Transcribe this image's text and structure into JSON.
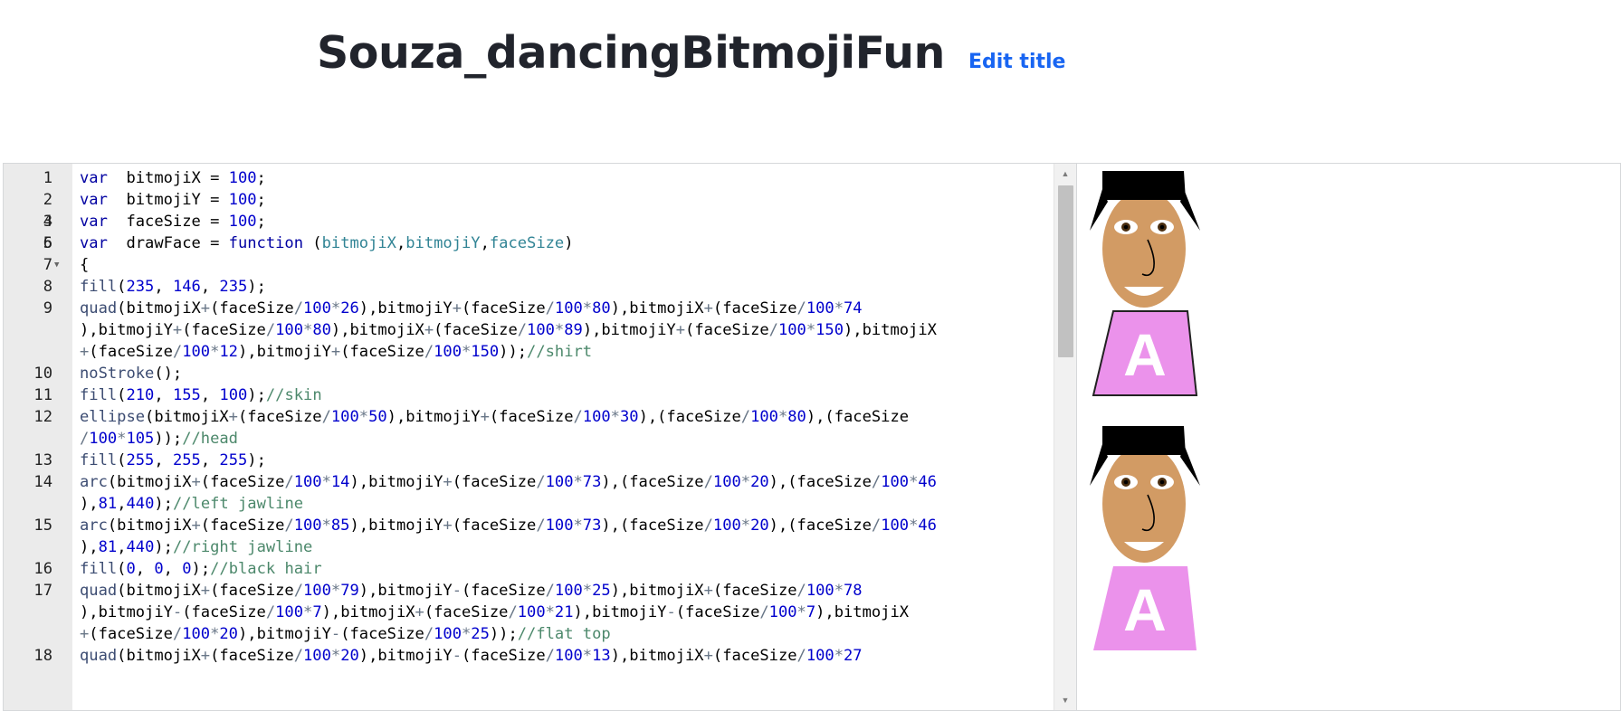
{
  "header": {
    "title": "Souza_dancingBitmojiFun",
    "edit_title_label": "Edit title"
  },
  "editor": {
    "lines": [
      {
        "num": "1",
        "tokens": [
          [
            "kw",
            "var"
          ],
          [
            "",
            "  bitmojiX = "
          ],
          [
            "num",
            "100"
          ],
          [
            "",
            ";"
          ]
        ]
      },
      {
        "num": "2",
        "tokens": [
          [
            "kw",
            "var"
          ],
          [
            "",
            "  bitmojiY = "
          ],
          [
            "num",
            "100"
          ],
          [
            "",
            ";"
          ]
        ]
      },
      {
        "num": "3",
        "tokens": [
          [
            "",
            ""
          ]
        ]
      },
      {
        "num": "4",
        "tokens": [
          [
            "kw",
            "var"
          ],
          [
            "",
            "  faceSize = "
          ],
          [
            "num",
            "100"
          ],
          [
            "",
            ";"
          ]
        ]
      },
      {
        "num": "5",
        "tokens": [
          [
            "",
            ""
          ]
        ]
      },
      {
        "num": "6",
        "tokens": [
          [
            "kw",
            "var"
          ],
          [
            "",
            "  drawFace = "
          ],
          [
            "kw",
            "function"
          ],
          [
            "",
            " ("
          ],
          [
            "param",
            "bitmojiX"
          ],
          [
            "",
            ","
          ],
          [
            "param",
            "bitmojiY"
          ],
          [
            "",
            ","
          ],
          [
            "param",
            "faceSize"
          ],
          [
            "",
            ")"
          ]
        ]
      },
      {
        "num": "7",
        "fold": true,
        "tokens": [
          [
            "",
            "{"
          ]
        ]
      },
      {
        "num": "8",
        "tokens": [
          [
            "fn",
            "fill"
          ],
          [
            "",
            "("
          ],
          [
            "num",
            "235"
          ],
          [
            "",
            ", "
          ],
          [
            "num",
            "146"
          ],
          [
            "",
            ", "
          ],
          [
            "num",
            "235"
          ],
          [
            "",
            ");"
          ]
        ]
      },
      {
        "num": "9",
        "tokens": [
          [
            "fn",
            "quad"
          ],
          [
            "",
            "(bitmojiX"
          ],
          [
            "op",
            "+"
          ],
          [
            "",
            "(faceSize"
          ],
          [
            "op",
            "/"
          ],
          [
            "num",
            "100"
          ],
          [
            "op",
            "*"
          ],
          [
            "num",
            "26"
          ],
          [
            "",
            "),bitmojiY"
          ],
          [
            "op",
            "+"
          ],
          [
            "",
            "(faceSize"
          ],
          [
            "op",
            "/"
          ],
          [
            "num",
            "100"
          ],
          [
            "op",
            "*"
          ],
          [
            "num",
            "80"
          ],
          [
            "",
            "),bitmojiX"
          ],
          [
            "op",
            "+"
          ],
          [
            "",
            "(faceSize"
          ],
          [
            "op",
            "/"
          ],
          [
            "num",
            "100"
          ],
          [
            "op",
            "*"
          ],
          [
            "num",
            "74"
          ]
        ]
      },
      {
        "num": "",
        "tokens": [
          [
            "",
            "),bitmojiY"
          ],
          [
            "op",
            "+"
          ],
          [
            "",
            "(faceSize"
          ],
          [
            "op",
            "/"
          ],
          [
            "num",
            "100"
          ],
          [
            "op",
            "*"
          ],
          [
            "num",
            "80"
          ],
          [
            "",
            "),bitmojiX"
          ],
          [
            "op",
            "+"
          ],
          [
            "",
            "(faceSize"
          ],
          [
            "op",
            "/"
          ],
          [
            "num",
            "100"
          ],
          [
            "op",
            "*"
          ],
          [
            "num",
            "89"
          ],
          [
            "",
            "),bitmojiY"
          ],
          [
            "op",
            "+"
          ],
          [
            "",
            "(faceSize"
          ],
          [
            "op",
            "/"
          ],
          [
            "num",
            "100"
          ],
          [
            "op",
            "*"
          ],
          [
            "num",
            "150"
          ],
          [
            "",
            "),bitmojiX"
          ]
        ]
      },
      {
        "num": "",
        "tokens": [
          [
            "op",
            "+"
          ],
          [
            "",
            "(faceSize"
          ],
          [
            "op",
            "/"
          ],
          [
            "num",
            "100"
          ],
          [
            "op",
            "*"
          ],
          [
            "num",
            "12"
          ],
          [
            "",
            "),bitmojiY"
          ],
          [
            "op",
            "+"
          ],
          [
            "",
            "(faceSize"
          ],
          [
            "op",
            "/"
          ],
          [
            "num",
            "100"
          ],
          [
            "op",
            "*"
          ],
          [
            "num",
            "150"
          ],
          [
            "",
            "));"
          ],
          [
            "cm",
            "//shirt"
          ]
        ]
      },
      {
        "num": "10",
        "tokens": [
          [
            "fn",
            "noStroke"
          ],
          [
            "",
            "();"
          ]
        ]
      },
      {
        "num": "11",
        "tokens": [
          [
            "fn",
            "fill"
          ],
          [
            "",
            "("
          ],
          [
            "num",
            "210"
          ],
          [
            "",
            ", "
          ],
          [
            "num",
            "155"
          ],
          [
            "",
            ", "
          ],
          [
            "num",
            "100"
          ],
          [
            "",
            ");"
          ],
          [
            "cm",
            "//skin"
          ]
        ]
      },
      {
        "num": "12",
        "tokens": [
          [
            "fn",
            "ellipse"
          ],
          [
            "",
            "(bitmojiX"
          ],
          [
            "op",
            "+"
          ],
          [
            "",
            "(faceSize"
          ],
          [
            "op",
            "/"
          ],
          [
            "num",
            "100"
          ],
          [
            "op",
            "*"
          ],
          [
            "num",
            "50"
          ],
          [
            "",
            "),bitmojiY"
          ],
          [
            "op",
            "+"
          ],
          [
            "",
            "(faceSize"
          ],
          [
            "op",
            "/"
          ],
          [
            "num",
            "100"
          ],
          [
            "op",
            "*"
          ],
          [
            "num",
            "30"
          ],
          [
            "",
            "),(faceSize"
          ],
          [
            "op",
            "/"
          ],
          [
            "num",
            "100"
          ],
          [
            "op",
            "*"
          ],
          [
            "num",
            "80"
          ],
          [
            "",
            "),(faceSize"
          ]
        ]
      },
      {
        "num": "",
        "tokens": [
          [
            "op",
            "/"
          ],
          [
            "num",
            "100"
          ],
          [
            "op",
            "*"
          ],
          [
            "num",
            "105"
          ],
          [
            "",
            "));"
          ],
          [
            "cm",
            "//head"
          ]
        ]
      },
      {
        "num": "13",
        "tokens": [
          [
            "fn",
            "fill"
          ],
          [
            "",
            "("
          ],
          [
            "num",
            "255"
          ],
          [
            "",
            ", "
          ],
          [
            "num",
            "255"
          ],
          [
            "",
            ", "
          ],
          [
            "num",
            "255"
          ],
          [
            "",
            ");"
          ]
        ]
      },
      {
        "num": "14",
        "tokens": [
          [
            "fn",
            "arc"
          ],
          [
            "",
            "(bitmojiX"
          ],
          [
            "op",
            "+"
          ],
          [
            "",
            "(faceSize"
          ],
          [
            "op",
            "/"
          ],
          [
            "num",
            "100"
          ],
          [
            "op",
            "*"
          ],
          [
            "num",
            "14"
          ],
          [
            "",
            "),bitmojiY"
          ],
          [
            "op",
            "+"
          ],
          [
            "",
            "(faceSize"
          ],
          [
            "op",
            "/"
          ],
          [
            "num",
            "100"
          ],
          [
            "op",
            "*"
          ],
          [
            "num",
            "73"
          ],
          [
            "",
            "),(faceSize"
          ],
          [
            "op",
            "/"
          ],
          [
            "num",
            "100"
          ],
          [
            "op",
            "*"
          ],
          [
            "num",
            "20"
          ],
          [
            "",
            "),(faceSize"
          ],
          [
            "op",
            "/"
          ],
          [
            "num",
            "100"
          ],
          [
            "op",
            "*"
          ],
          [
            "num",
            "46"
          ]
        ]
      },
      {
        "num": "",
        "tokens": [
          [
            "",
            "),"
          ],
          [
            "num",
            "81"
          ],
          [
            "",
            ","
          ],
          [
            "num",
            "440"
          ],
          [
            "",
            ");"
          ],
          [
            "cm",
            "//left jawline"
          ]
        ]
      },
      {
        "num": "15",
        "tokens": [
          [
            "fn",
            "arc"
          ],
          [
            "",
            "(bitmojiX"
          ],
          [
            "op",
            "+"
          ],
          [
            "",
            "(faceSize"
          ],
          [
            "op",
            "/"
          ],
          [
            "num",
            "100"
          ],
          [
            "op",
            "*"
          ],
          [
            "num",
            "85"
          ],
          [
            "",
            "),bitmojiY"
          ],
          [
            "op",
            "+"
          ],
          [
            "",
            "(faceSize"
          ],
          [
            "op",
            "/"
          ],
          [
            "num",
            "100"
          ],
          [
            "op",
            "*"
          ],
          [
            "num",
            "73"
          ],
          [
            "",
            "),(faceSize"
          ],
          [
            "op",
            "/"
          ],
          [
            "num",
            "100"
          ],
          [
            "op",
            "*"
          ],
          [
            "num",
            "20"
          ],
          [
            "",
            "),(faceSize"
          ],
          [
            "op",
            "/"
          ],
          [
            "num",
            "100"
          ],
          [
            "op",
            "*"
          ],
          [
            "num",
            "46"
          ]
        ]
      },
      {
        "num": "",
        "tokens": [
          [
            "",
            "),"
          ],
          [
            "num",
            "81"
          ],
          [
            "",
            ","
          ],
          [
            "num",
            "440"
          ],
          [
            "",
            ");"
          ],
          [
            "cm",
            "//right jawline"
          ]
        ]
      },
      {
        "num": "16",
        "tokens": [
          [
            "fn",
            "fill"
          ],
          [
            "",
            "("
          ],
          [
            "num",
            "0"
          ],
          [
            "",
            ", "
          ],
          [
            "num",
            "0"
          ],
          [
            "",
            ", "
          ],
          [
            "num",
            "0"
          ],
          [
            "",
            ");"
          ],
          [
            "cm",
            "//black hair"
          ]
        ]
      },
      {
        "num": "17",
        "tokens": [
          [
            "fn",
            "quad"
          ],
          [
            "",
            "(bitmojiX"
          ],
          [
            "op",
            "+"
          ],
          [
            "",
            "(faceSize"
          ],
          [
            "op",
            "/"
          ],
          [
            "num",
            "100"
          ],
          [
            "op",
            "*"
          ],
          [
            "num",
            "79"
          ],
          [
            "",
            "),bitmojiY"
          ],
          [
            "op",
            "-"
          ],
          [
            "",
            "(faceSize"
          ],
          [
            "op",
            "/"
          ],
          [
            "num",
            "100"
          ],
          [
            "op",
            "*"
          ],
          [
            "num",
            "25"
          ],
          [
            "",
            "),bitmojiX"
          ],
          [
            "op",
            "+"
          ],
          [
            "",
            "(faceSize"
          ],
          [
            "op",
            "/"
          ],
          [
            "num",
            "100"
          ],
          [
            "op",
            "*"
          ],
          [
            "num",
            "78"
          ]
        ]
      },
      {
        "num": "",
        "tokens": [
          [
            "",
            "),bitmojiY"
          ],
          [
            "op",
            "-"
          ],
          [
            "",
            "(faceSize"
          ],
          [
            "op",
            "/"
          ],
          [
            "num",
            "100"
          ],
          [
            "op",
            "*"
          ],
          [
            "num",
            "7"
          ],
          [
            "",
            "),bitmojiX"
          ],
          [
            "op",
            "+"
          ],
          [
            "",
            "(faceSize"
          ],
          [
            "op",
            "/"
          ],
          [
            "num",
            "100"
          ],
          [
            "op",
            "*"
          ],
          [
            "num",
            "21"
          ],
          [
            "",
            "),bitmojiY"
          ],
          [
            "op",
            "-"
          ],
          [
            "",
            "(faceSize"
          ],
          [
            "op",
            "/"
          ],
          [
            "num",
            "100"
          ],
          [
            "op",
            "*"
          ],
          [
            "num",
            "7"
          ],
          [
            "",
            "),bitmojiX"
          ]
        ]
      },
      {
        "num": "",
        "tokens": [
          [
            "op",
            "+"
          ],
          [
            "",
            "(faceSize"
          ],
          [
            "op",
            "/"
          ],
          [
            "num",
            "100"
          ],
          [
            "op",
            "*"
          ],
          [
            "num",
            "20"
          ],
          [
            "",
            "),bitmojiY"
          ],
          [
            "op",
            "-"
          ],
          [
            "",
            "(faceSize"
          ],
          [
            "op",
            "/"
          ],
          [
            "num",
            "100"
          ],
          [
            "op",
            "*"
          ],
          [
            "num",
            "25"
          ],
          [
            "",
            "));"
          ],
          [
            "cm",
            "//flat top"
          ]
        ]
      },
      {
        "num": "18",
        "tokens": [
          [
            "fn",
            "quad"
          ],
          [
            "",
            "(bitmojiX"
          ],
          [
            "op",
            "+"
          ],
          [
            "",
            "(faceSize"
          ],
          [
            "op",
            "/"
          ],
          [
            "num",
            "100"
          ],
          [
            "op",
            "*"
          ],
          [
            "num",
            "20"
          ],
          [
            "",
            "),bitmojiY"
          ],
          [
            "op",
            "-"
          ],
          [
            "",
            "(faceSize"
          ],
          [
            "op",
            "/"
          ],
          [
            "num",
            "100"
          ],
          [
            "op",
            "*"
          ],
          [
            "num",
            "13"
          ],
          [
            "",
            "),bitmojiX"
          ],
          [
            "op",
            "+"
          ],
          [
            "",
            "(faceSize"
          ],
          [
            "op",
            "/"
          ],
          [
            "num",
            "100"
          ],
          [
            "op",
            "*"
          ],
          [
            "num",
            "27"
          ]
        ]
      }
    ]
  },
  "canvas": {
    "shirt_letter": "A",
    "colors": {
      "shirt": "#eb92eb",
      "skin": "#d29b64",
      "hair": "#000000",
      "teeth": "#ffffff",
      "pupil": "#4a2e10"
    }
  }
}
